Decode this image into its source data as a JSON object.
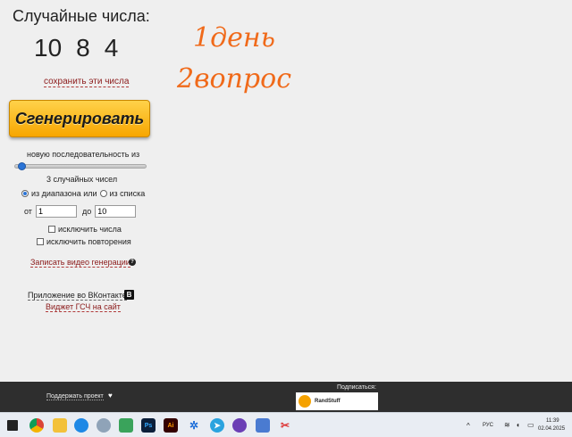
{
  "title": "Случайные числа:",
  "numbers": [
    "10",
    "8",
    "4"
  ],
  "save_link": "сохранить эти числа",
  "generate_button": "Сгенерировать",
  "sequence_label": "новую последовательность из",
  "slider": {
    "fraction": 0.02
  },
  "count_label": "3 случайных чисел",
  "mode": {
    "range_label": "из диапазона или",
    "list_label": "из списка",
    "selected": "range"
  },
  "range": {
    "from_label": "от",
    "from_value": "1",
    "to_label": "до",
    "to_value": "10"
  },
  "exclude_numbers_label": "исключить числа",
  "exclude_repeats_label": "исключить повторения",
  "video_link": "Записать видео генерации",
  "vk_link": "Приложение во ВКонтакте",
  "vk_badge": "В",
  "widget_link": "Виджет ГСЧ на сайт",
  "handwriting": {
    "line1": "1день",
    "line2": "2вопрос",
    "color": "#f06a1a"
  },
  "footer": {
    "support": "Поддержать проект",
    "subscribe": "Подписаться:",
    "brand": "RandStuff",
    "brand_logo_text": "RandStuff"
  },
  "taskbar": {
    "lang": "РУС",
    "time": "11:39",
    "date": "02.04.2025",
    "photoshop": "Ps",
    "illustrator": "Ai"
  },
  "colors": {
    "button_top": "#ffd24a",
    "button_bottom": "#f7a600",
    "link": "#8b1a1a",
    "accent": "#2b74d6"
  }
}
